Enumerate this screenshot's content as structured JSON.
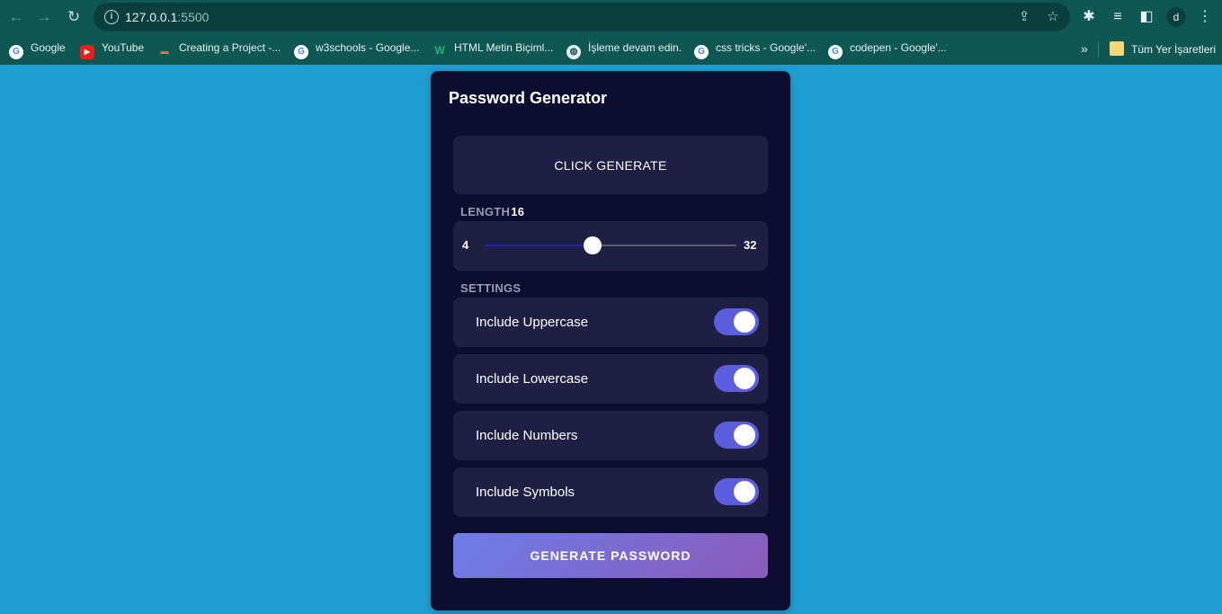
{
  "browser": {
    "url_host": "127.0.0.1",
    "url_port": ":5500",
    "avatar_initial": "d",
    "bookmarks": [
      {
        "label": "Google",
        "icon": "google-icon"
      },
      {
        "label": "YouTube",
        "icon": "youtube-icon"
      },
      {
        "label": "Creating a Project -...",
        "icon": "project-icon"
      },
      {
        "label": "w3schools - Google...",
        "icon": "google-icon"
      },
      {
        "label": "HTML Metin Biçiml...",
        "icon": "w-icon"
      },
      {
        "label": "İşleme devam edin.",
        "icon": "globe-icon"
      },
      {
        "label": "css tricks - Google'...",
        "icon": "google-icon"
      },
      {
        "label": "codepen - Google'...",
        "icon": "google-icon"
      }
    ],
    "more_bookmarks_label": "»",
    "all_bookmarks_label": "Tüm Yer İşaretleri"
  },
  "app": {
    "title": "Password Generator",
    "result_text": "CLICK GENERATE",
    "length": {
      "label": "LENGTH",
      "value": "16",
      "min": "4",
      "max": "32",
      "fill_fraction": 0.43
    },
    "settings_label": "SETTINGS",
    "settings": [
      {
        "label": "Include Uppercase",
        "enabled": true
      },
      {
        "label": "Include Lowercase",
        "enabled": true
      },
      {
        "label": "Include Numbers",
        "enabled": true
      },
      {
        "label": "Include Symbols",
        "enabled": true
      }
    ],
    "generate_label": "GENERATE PASSWORD"
  },
  "colors": {
    "page_background": "#1f9ed1",
    "card_background": "#0d0d30",
    "panel_background": "#1e1f42",
    "toggle_on": "#5b5fdf",
    "slider_fill": "#1b22c9",
    "button_gradient_start": "#6d7de8",
    "button_gradient_end": "#8a5bb8"
  }
}
